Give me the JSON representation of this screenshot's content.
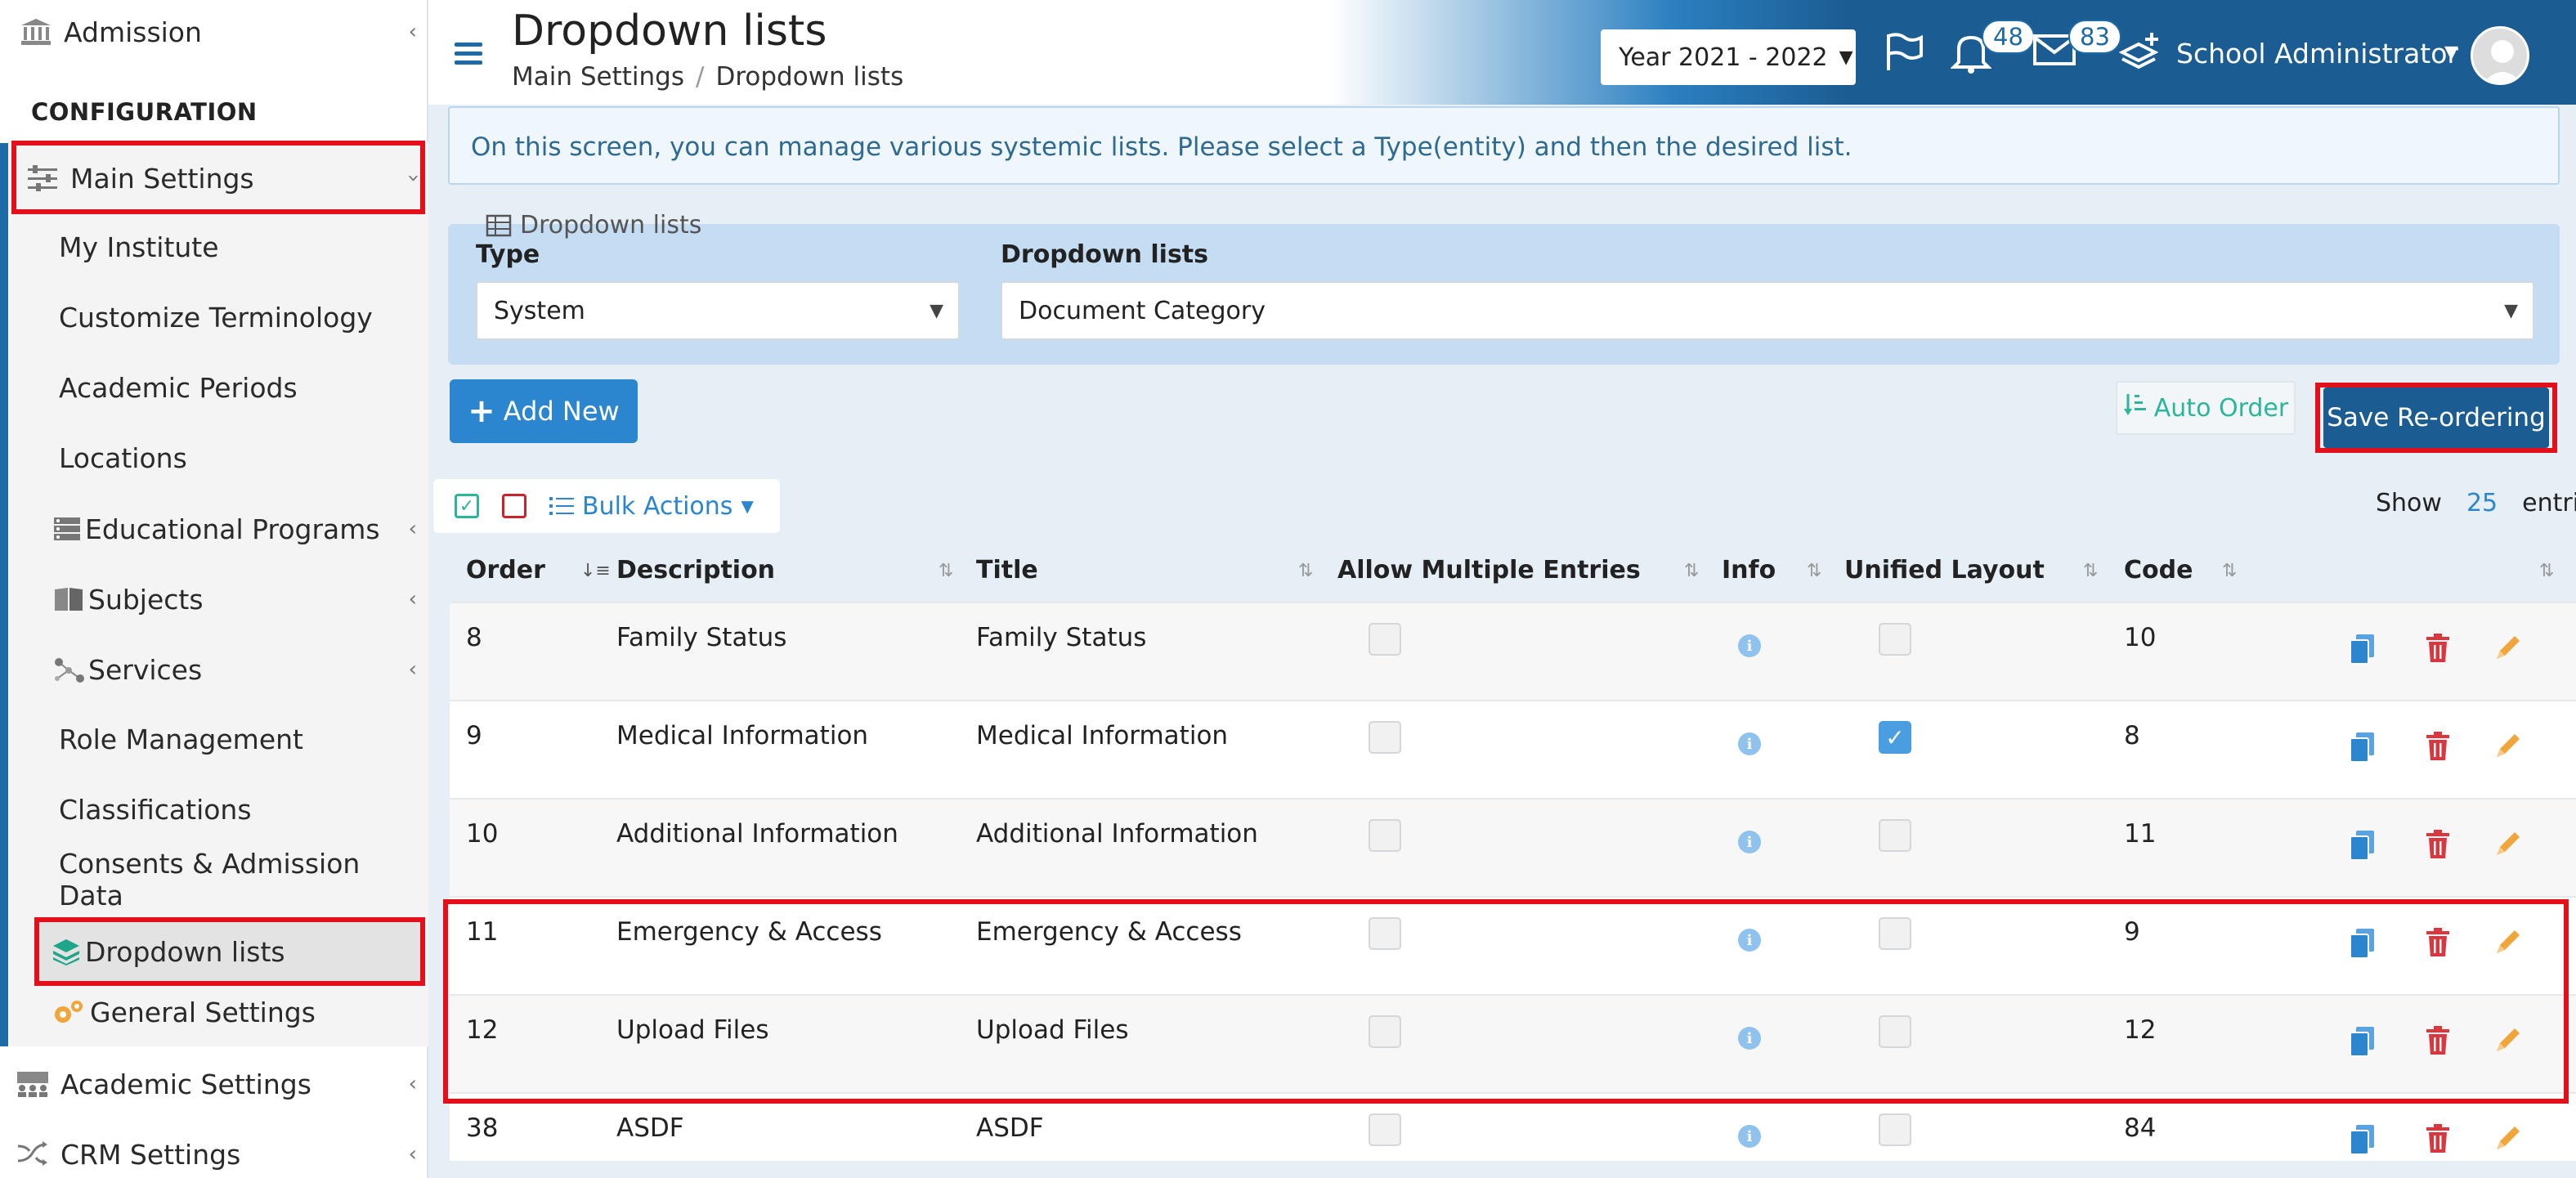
{
  "sidebar": {
    "top_item": "Admission",
    "heading": "CONFIGURATION",
    "main_settings": "Main Settings",
    "sub_items": [
      "My Institute",
      "Customize Terminology",
      "Academic Periods",
      "Locations",
      "Educational Programs",
      "Subjects",
      "Services",
      "Role Management",
      "Classifications",
      "Consents & Admission Data",
      "Dropdown lists",
      "General Settings"
    ],
    "academic_settings": "Academic Settings",
    "crm_settings": "CRM Settings"
  },
  "header": {
    "title": "Dropdown lists",
    "breadcrumb": [
      "Main Settings",
      "Dropdown lists"
    ],
    "year": "Year 2021 - 2022",
    "notifications_count": "48",
    "messages_count": "83",
    "user_name": "School Administrator"
  },
  "info_text": "On this screen, you can manage various systemic lists. Please select a Type(entity) and then the desired list.",
  "filter": {
    "legend": "Dropdown lists",
    "type_label": "Type",
    "type_value": "System",
    "list_label": "Dropdown lists",
    "list_value": "Document Category"
  },
  "buttons": {
    "add_new": "Add New",
    "auto_order": "Auto Order",
    "save_reordering": "Save Re-ordering"
  },
  "bulk": {
    "bulk_actions": "Bulk Actions",
    "show": "Show",
    "entries_count": "25",
    "entries": "entries"
  },
  "table": {
    "columns": [
      "Order",
      "Description",
      "Title",
      "Allow Multiple Entries",
      "Info",
      "Unified Layout",
      "Code"
    ],
    "rows": [
      {
        "order": "8",
        "description": "Family Status",
        "title": "Family Status",
        "allow_multiple": false,
        "unified": false,
        "code": "10"
      },
      {
        "order": "9",
        "description": "Medical Information",
        "title": "Medical Information",
        "allow_multiple": false,
        "unified": true,
        "code": "8"
      },
      {
        "order": "10",
        "description": "Additional Information",
        "title": "Additional Information",
        "allow_multiple": false,
        "unified": false,
        "code": "11"
      },
      {
        "order": "11",
        "description": "Emergency & Access",
        "title": "Emergency & Access",
        "allow_multiple": false,
        "unified": false,
        "code": "9"
      },
      {
        "order": "12",
        "description": "Upload Files",
        "title": "Upload Files",
        "allow_multiple": false,
        "unified": false,
        "code": "12"
      },
      {
        "order": "38",
        "description": "ASDF",
        "title": "ASDF",
        "allow_multiple": false,
        "unified": false,
        "code": "84"
      }
    ]
  },
  "colors": {
    "primary": "#1b5d93",
    "accent_blue": "#2b86cf",
    "highlight_red": "#e3101c",
    "teal": "#2bb59a",
    "delete_red": "#d9363e",
    "edit_orange": "#f0a63a"
  }
}
